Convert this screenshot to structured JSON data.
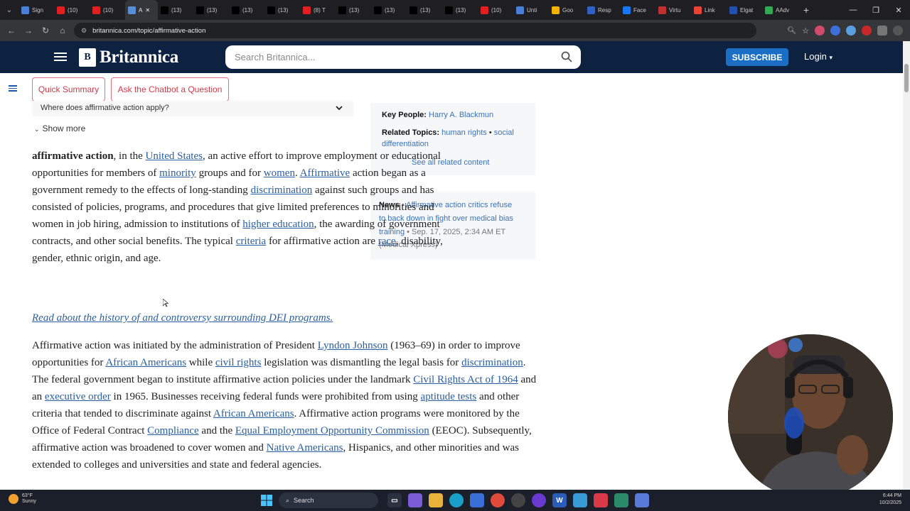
{
  "browser": {
    "tabs": [
      {
        "label": "Sign",
        "color": "#4a7fd8"
      },
      {
        "label": "(10)",
        "color": "#e02020"
      },
      {
        "label": "(10)",
        "color": "#e02020"
      },
      {
        "label": "A",
        "color": "#5a8fd8",
        "active": true
      },
      {
        "label": "(13)",
        "color": "#000000"
      },
      {
        "label": "(13)",
        "color": "#000000"
      },
      {
        "label": "(13)",
        "color": "#000000"
      },
      {
        "label": "(13)",
        "color": "#000000"
      },
      {
        "label": "(8) T",
        "color": "#e02020"
      },
      {
        "label": "(13)",
        "color": "#000000"
      },
      {
        "label": "(13)",
        "color": "#000000"
      },
      {
        "label": "(13)",
        "color": "#000000"
      },
      {
        "label": "(13)",
        "color": "#000000"
      },
      {
        "label": "(10)",
        "color": "#e02020"
      },
      {
        "label": "Unti",
        "color": "#4a7fd8"
      },
      {
        "label": "Goo",
        "color": "#f0b400"
      },
      {
        "label": "Resp",
        "color": "#3060c0"
      },
      {
        "label": "Face",
        "color": "#1877f2"
      },
      {
        "label": "Virtu",
        "color": "#c03030"
      },
      {
        "label": "Link",
        "color": "#ea4335"
      },
      {
        "label": "Elgat",
        "color": "#2050b0"
      },
      {
        "label": "AAdv",
        "color": "#34a853"
      }
    ],
    "url": "britannica.com/topic/affirmative-action"
  },
  "header": {
    "logo_mark": "B",
    "logo_text": "Britannica",
    "search_placeholder": "Search Britannica...",
    "subscribe": "SUBSCRIBE",
    "login": "Login"
  },
  "page": {
    "quick_summary": "Quick Summary",
    "chatbot": "Ask the Chatbot a Question",
    "question": "Where does affirmative action apply?",
    "show_more": "Show more",
    "sidebar": {
      "key_people_label": "Key People:",
      "key_people_value": "Harry A. Blackmun",
      "related_label": "Related Topics:",
      "related_1": "human rights",
      "related_sep": "•",
      "related_2": "social",
      "related_3": "differentiation",
      "see_all": "See all related content"
    },
    "news": {
      "label": "News",
      "sep": "•",
      "headline_1": "Affirmative action critics refuse",
      "headline_2": "to back down in fight over medical bias",
      "headline_3": "training",
      "date": "• Sep. 17, 2025, 2:34 AM ET",
      "source": "(Medical Xpress)"
    },
    "lead": {
      "term": "affirmative action",
      "t1": ", in the ",
      "l_us": "United States",
      "t2": ", an active effort to improve employment or educational opportunities for members of ",
      "l_minority": "minority",
      "t3": " groups and for ",
      "l_women": "women",
      "t4": ". ",
      "l_affirmative": "Affirmative",
      "t5": " action began as a government remedy to the effects of long-standing ",
      "l_discrimination": "discrimination",
      "t6": " against such groups and has consisted of policies, programs, and procedures that give limited preferences to minorities and women in job hiring, admission to institutions of ",
      "l_higher": "higher education",
      "t7": ", the awarding of government contracts, and other social benefits. The typical ",
      "l_criteria": "criteria",
      "t8": " for affirmative action are ",
      "l_race": "race",
      "t9": ", disability, gender, ethnic origin, and age."
    },
    "read_about": "Read about the history of and controversy surrounding DEI programs.",
    "body": {
      "t1": "Affirmative action was initiated by the administration of President ",
      "l_lbj": "Lyndon Johnson",
      "t2": " (1963–69) in order to improve opportunities for ",
      "l_aa": "African Americans",
      "t3": " while ",
      "l_cr": "civil rights",
      "t4": " legislation was dismantling the legal basis for ",
      "l_disc": "discrimination",
      "t5": ". The federal government began to institute affirmative action policies under the landmark ",
      "l_cra": "Civil Rights Act of 1964",
      "t6": " and an ",
      "l_eo": "executive order",
      "t7": " in 1965. Businesses receiving federal funds were prohibited from using ",
      "l_apt": "aptitude tests",
      "t8": " and other criteria that tended to discriminate against ",
      "l_aa2": "African Americans",
      "t9": ". Affirmative action programs were monitored by the Office of Federal Contract ",
      "l_comp": "Compliance",
      "t10": " and the ",
      "l_eeoc": "Equal Employment Opportunity Commission",
      "t11": " (EEOC). Subsequently, affirmative action was broadened to cover women and ",
      "l_na": "Native Americans",
      "t12": ", Hispanics, and other minorities and was extended to colleges and universities and state and federal agencies."
    }
  },
  "taskbar": {
    "temp": "63°F",
    "condition": "Sunny",
    "search": "Search",
    "time": "6:44 PM",
    "date": "10/2/2025"
  }
}
